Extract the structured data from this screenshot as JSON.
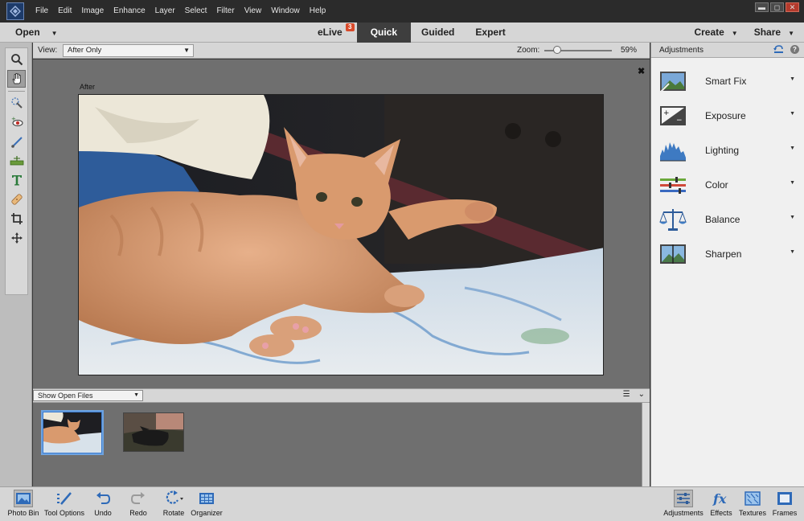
{
  "menubar": {
    "items": [
      "File",
      "Edit",
      "Image",
      "Enhance",
      "Layer",
      "Select",
      "Filter",
      "View",
      "Window",
      "Help"
    ],
    "window_controls": [
      "▬",
      "◻",
      "✕"
    ]
  },
  "modebar": {
    "open_label": "Open",
    "tabs": [
      {
        "label": "eLive",
        "badge": "3"
      },
      {
        "label": "Quick"
      },
      {
        "label": "Guided"
      },
      {
        "label": "Expert"
      }
    ],
    "create_label": "Create",
    "share_label": "Share"
  },
  "view_bar": {
    "view_label": "View:",
    "view_value": "After Only",
    "zoom_label": "Zoom:",
    "zoom_value": "59%",
    "zoom_level": 0.59
  },
  "canvas": {
    "after_label": "After",
    "close_glyph": "✖"
  },
  "photo_bin": {
    "filter_value": "Show Open Files"
  },
  "adjustments_panel": {
    "title": "Adjustments",
    "items": [
      {
        "label": "Smart Fix",
        "icon": "smart-fix-icon"
      },
      {
        "label": "Exposure",
        "icon": "exposure-icon"
      },
      {
        "label": "Lighting",
        "icon": "lighting-icon"
      },
      {
        "label": "Color",
        "icon": "color-icon"
      },
      {
        "label": "Balance",
        "icon": "balance-icon"
      },
      {
        "label": "Sharpen",
        "icon": "sharpen-icon"
      }
    ]
  },
  "bottombar": {
    "left": [
      {
        "label": "Photo Bin",
        "icon": "photo-bin-icon"
      },
      {
        "label": "Tool Options",
        "icon": "tool-options-icon"
      },
      {
        "label": "Undo",
        "icon": "undo-icon"
      },
      {
        "label": "Redo",
        "icon": "redo-icon"
      },
      {
        "label": "Rotate",
        "icon": "rotate-icon"
      },
      {
        "label": "Organizer",
        "icon": "organizer-icon"
      }
    ],
    "right": [
      {
        "label": "Adjustments",
        "icon": "adjustments-icon"
      },
      {
        "label": "Effects",
        "icon": "effects-icon"
      },
      {
        "label": "Textures",
        "icon": "textures-icon"
      },
      {
        "label": "Frames",
        "icon": "frames-icon"
      }
    ]
  }
}
